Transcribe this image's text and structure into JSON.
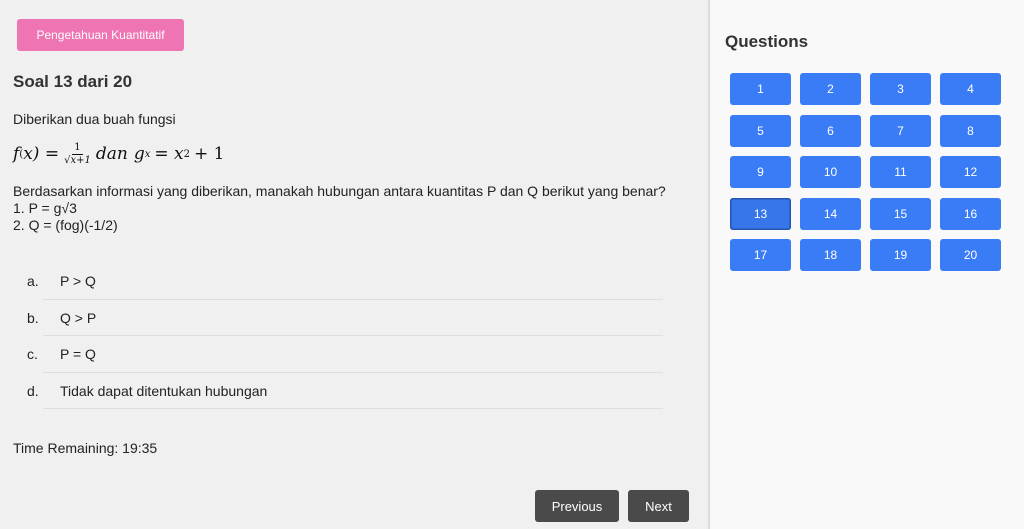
{
  "main": {
    "category_label": "Pengetahuan Kuantitatif",
    "question_title": "Soal 13 dari 20",
    "intro": "Diberikan dua buah fungsi",
    "formula": {
      "f_name": "f",
      "f_sub": "(",
      "f_arg": "x) =",
      "frac_num": "1",
      "frac_den": "√x+1",
      "conj": "dan",
      "g_name": "g",
      "g_sub": "x",
      "g_eq": "= x",
      "g_sup": "2",
      "g_tail": "+ 1"
    },
    "statement_lines": [
      "Berdasarkan informasi yang diberikan, manakah hubungan antara kuantitas P dan Q berikut yang benar?",
      "1. P = g√3",
      "2. Q = (fog)(-1/2)"
    ],
    "options": [
      {
        "letter": "a.",
        "text": "P > Q"
      },
      {
        "letter": "b.",
        "text": "Q > P"
      },
      {
        "letter": "c.",
        "text": "P = Q"
      },
      {
        "letter": "d.",
        "text": "Tidak dapat ditentukan hubungan"
      }
    ],
    "timer": "Time Remaining: 19:35",
    "previous_label": "Previous",
    "next_label": "Next"
  },
  "sidebar": {
    "title": "Questions",
    "current": 13,
    "questions": [
      "1",
      "2",
      "3",
      "4",
      "5",
      "6",
      "7",
      "8",
      "9",
      "10",
      "11",
      "12",
      "13",
      "14",
      "15",
      "16",
      "17",
      "18",
      "19",
      "20"
    ]
  },
  "colors": {
    "category_pink": "#ef74b4",
    "question_blue": "#3a7cf5",
    "nav_button_dark": "#4a4a4a"
  }
}
